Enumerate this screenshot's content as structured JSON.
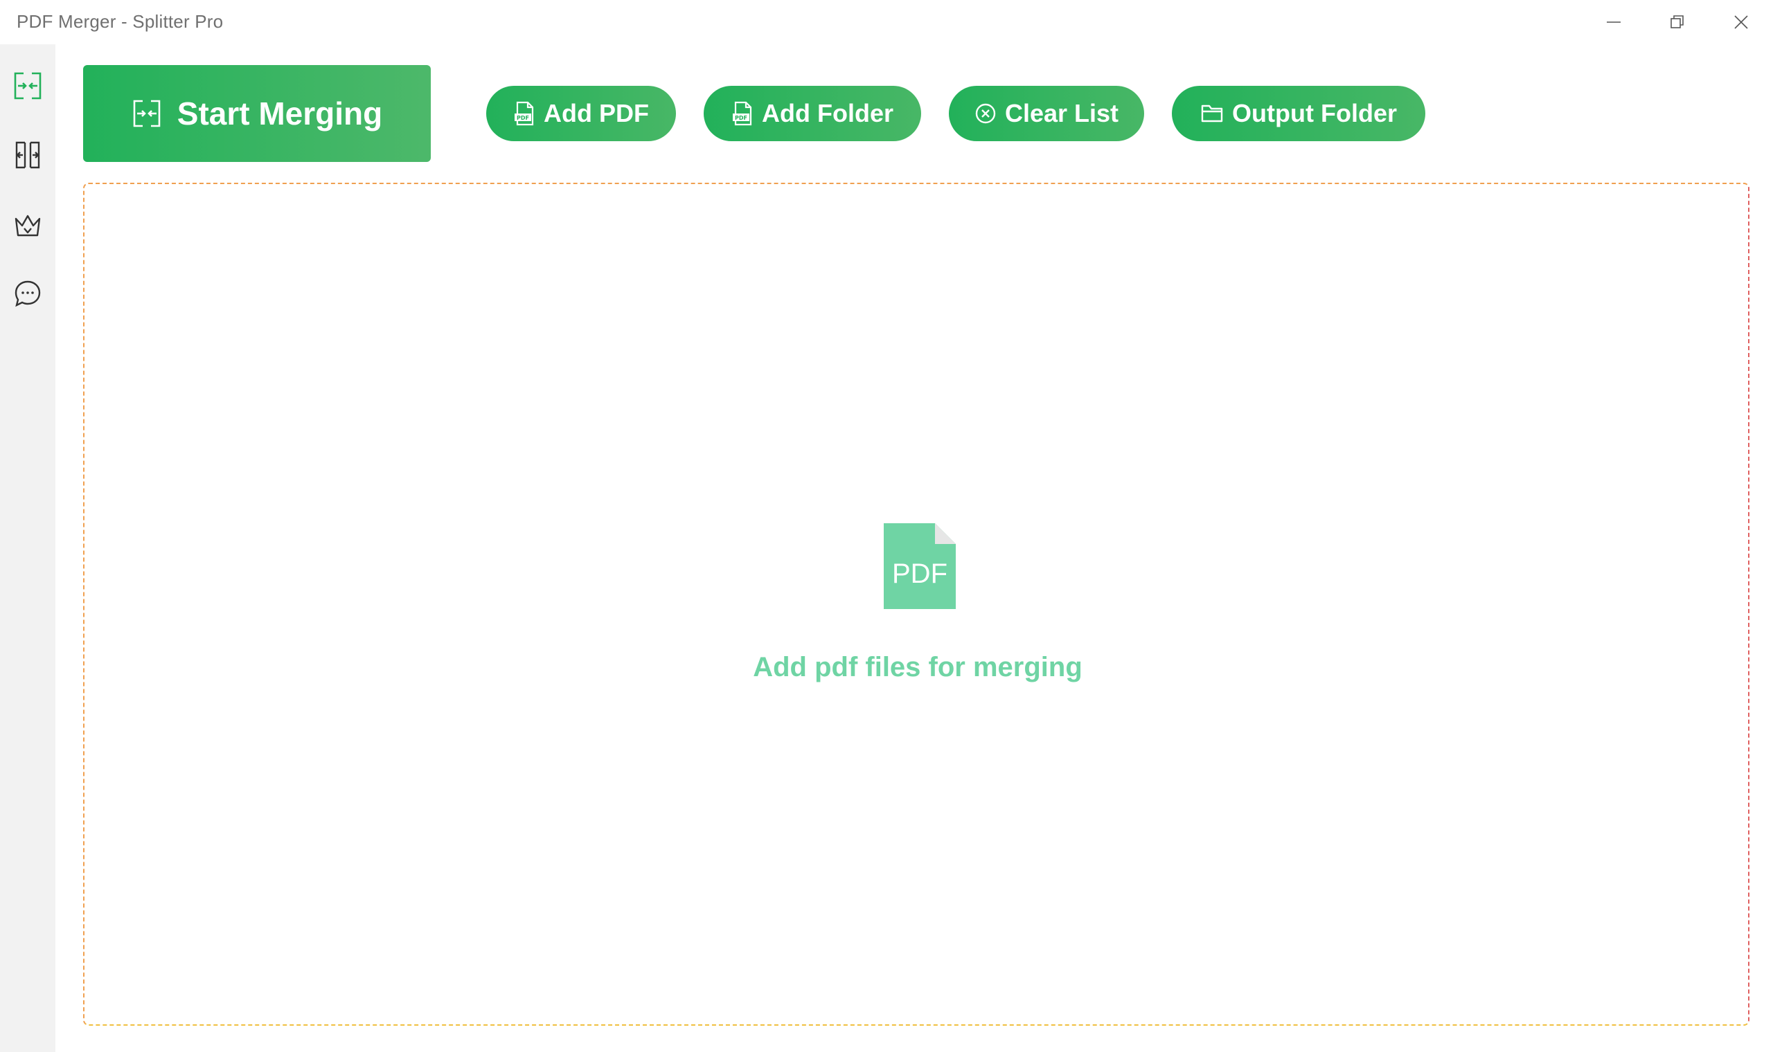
{
  "window": {
    "title": "PDF Merger - Splitter Pro",
    "controls": {
      "minimize": "minimize-icon",
      "maximize": "restore-icon",
      "close": "close-icon"
    }
  },
  "sidebar": {
    "items": [
      {
        "id": "merge",
        "icon": "merge-icon",
        "active": true
      },
      {
        "id": "split",
        "icon": "split-icon",
        "active": false
      },
      {
        "id": "vip",
        "icon": "crown-icon",
        "active": false
      },
      {
        "id": "feedback",
        "icon": "chat-icon",
        "active": false
      }
    ]
  },
  "toolbar": {
    "start_label": "Start Merging",
    "add_pdf_label": "Add PDF",
    "add_folder_label": "Add Folder",
    "clear_list_label": "Clear List",
    "output_folder_label": "Output Folder"
  },
  "dropzone": {
    "icon_text": "PDF",
    "hint": "Add pdf files for merging"
  },
  "colors": {
    "accent": "#22b15a",
    "accent_light": "#6fd4a4",
    "sidebar_bg": "#f2f2f2"
  }
}
